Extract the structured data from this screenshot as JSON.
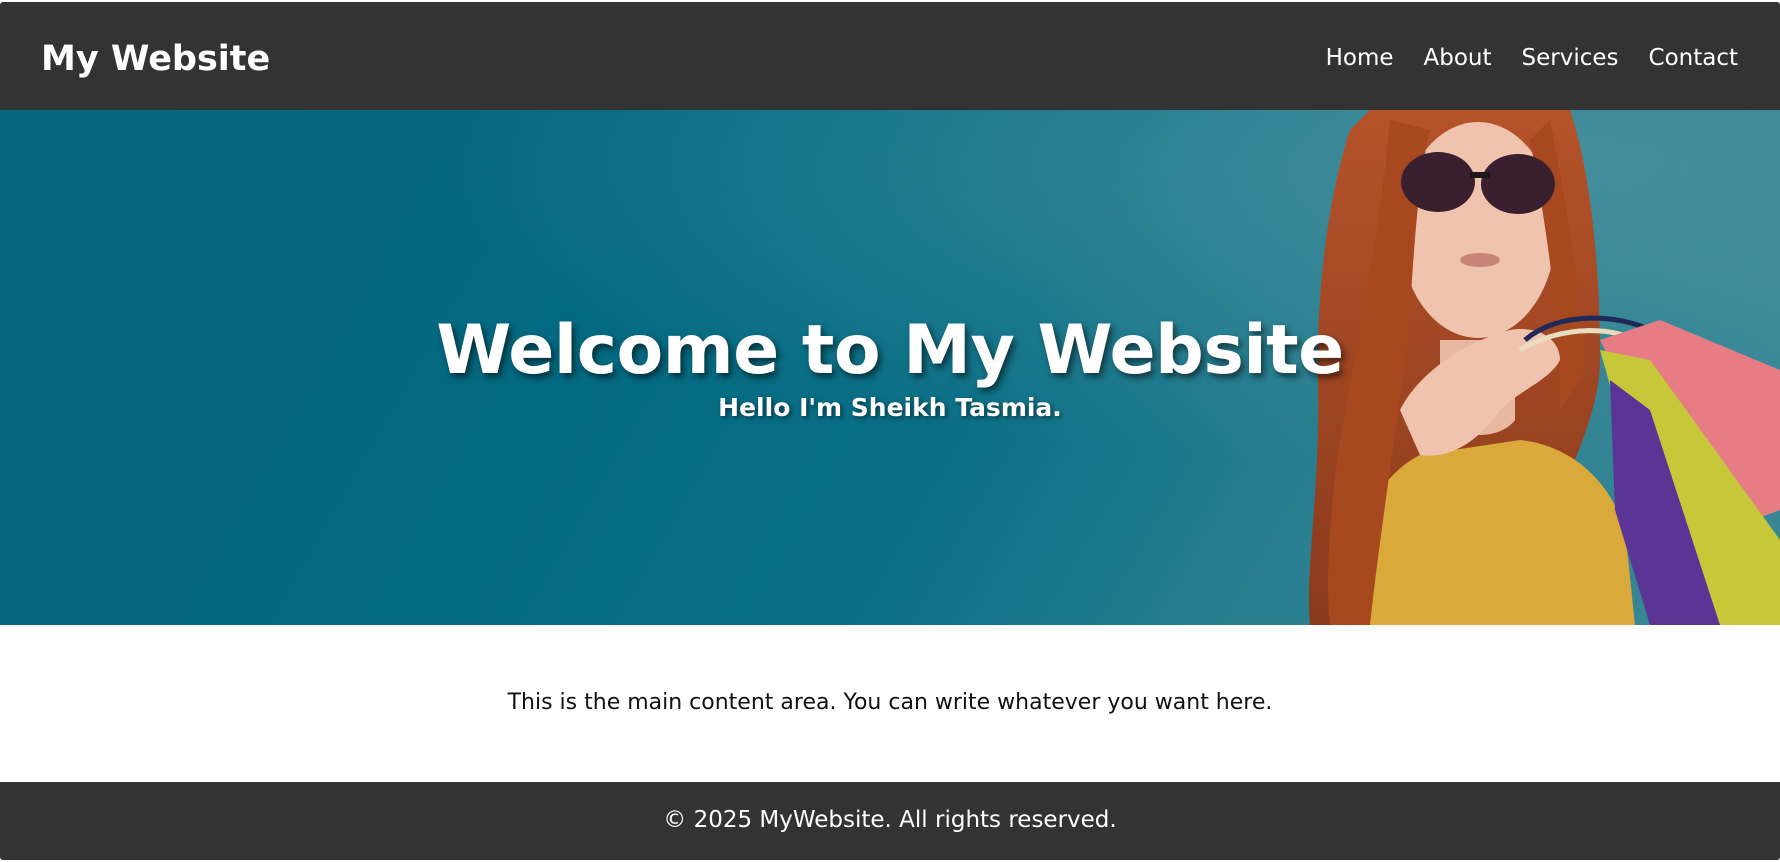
{
  "header": {
    "logo": "My Website",
    "nav": [
      {
        "label": "Home"
      },
      {
        "label": "About"
      },
      {
        "label": "Services"
      },
      {
        "label": "Contact"
      }
    ]
  },
  "hero": {
    "title": "Welcome to My Website",
    "subtitle": "Hello I'm Sheikh Tasmia.",
    "background_color": "#046a82"
  },
  "main": {
    "text": "This is the main content area. You can write whatever you want here."
  },
  "footer": {
    "text": "© 2025 MyWebsite. All rights reserved."
  },
  "colors": {
    "bar": "#333333",
    "text_light": "#ffffff",
    "text_dark": "#111111"
  }
}
